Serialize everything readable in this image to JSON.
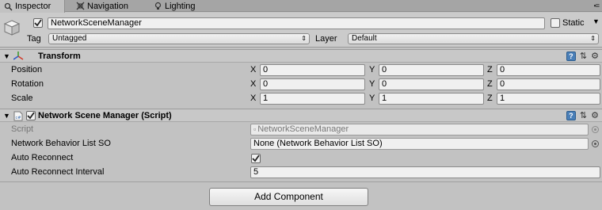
{
  "tabs": [
    {
      "label": "Inspector",
      "icon": "inspector-icon",
      "active": true
    },
    {
      "label": "Navigation",
      "icon": "navigation-icon",
      "active": false
    },
    {
      "label": "Lighting",
      "icon": "lighting-icon",
      "active": false
    }
  ],
  "header": {
    "object_name": "NetworkSceneManager",
    "active_checked": true,
    "static_label": "Static",
    "static_checked": false,
    "tag_label": "Tag",
    "tag_value": "Untagged",
    "layer_label": "Layer",
    "layer_value": "Default"
  },
  "transform": {
    "title": "Transform",
    "rows": [
      {
        "label": "Position",
        "x": "0",
        "y": "0",
        "z": "0"
      },
      {
        "label": "Rotation",
        "x": "0",
        "y": "0",
        "z": "0"
      },
      {
        "label": "Scale",
        "x": "1",
        "y": "1",
        "z": "1"
      }
    ],
    "axes": {
      "x": "X",
      "y": "Y",
      "z": "Z"
    }
  },
  "script_component": {
    "title": "Network Scene Manager (Script)",
    "enabled": true,
    "script_label": "Script",
    "script_value": "NetworkSceneManager",
    "list_label": "Network Behavior List SO",
    "list_value": "None (Network Behavior List SO)",
    "auto_reconnect_label": "Auto Reconnect",
    "auto_reconnect_checked": true,
    "interval_label": "Auto Reconnect Interval",
    "interval_value": "5"
  },
  "add_component_label": "Add Component",
  "colors": {
    "help_blue": "#4a7fb8",
    "panel": "#c2c2c2"
  }
}
